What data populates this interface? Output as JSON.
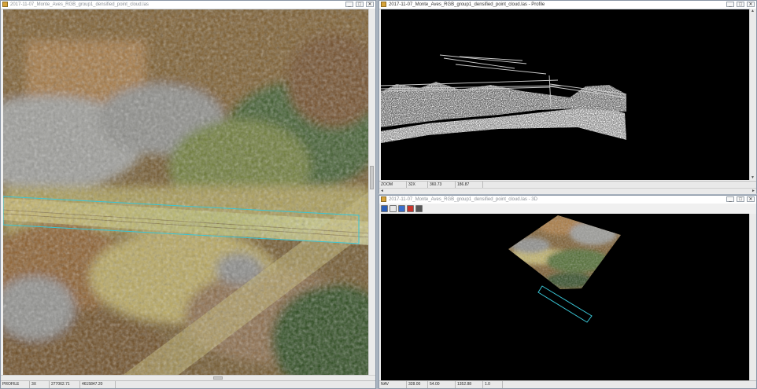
{
  "left_window": {
    "title": "2017-11-07_Monte_Aves_RGB_group1_densified_point_cloud.las",
    "controls": [
      "_",
      "□",
      "✕"
    ],
    "status": [
      "PROFILE",
      "3X",
      "277062.71",
      "4615847.20"
    ]
  },
  "profile_window": {
    "title": "2017-11-07_Monte_Aves_RGB_group1_densified_point_cloud.las - Profile",
    "controls": [
      "_",
      "□",
      "✕"
    ],
    "status": [
      "ZOOM",
      "32X",
      "360.73",
      "186.87"
    ]
  },
  "view3d_window": {
    "title": "2017-11-07_Monte_Aves_RGB_group1_densified_point_cloud.las - 3D",
    "controls": [
      "_",
      "□",
      "✕"
    ],
    "toolbar_icons": [
      "home-icon",
      "rotate-icon",
      "pan-icon",
      "zoom-icon",
      "grid-icon"
    ],
    "status": [
      "NAV",
      "328.00",
      "54.00",
      "1352.88",
      "1.0"
    ]
  },
  "colors": {
    "desktop": "#a9b3bf",
    "viewport": "#000000",
    "selection": "#39c6d6"
  }
}
